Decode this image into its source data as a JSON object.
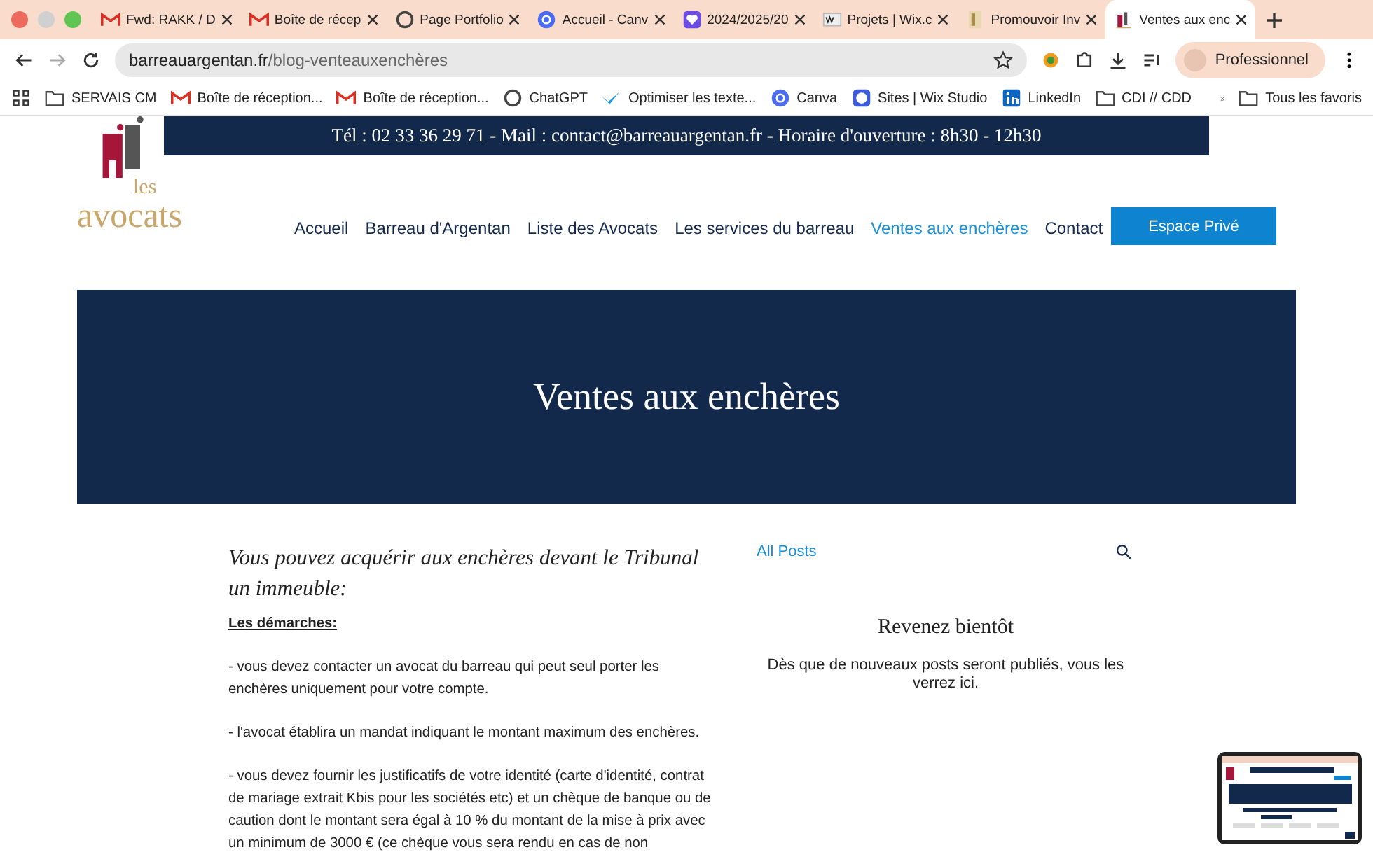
{
  "browser": {
    "tabs": [
      {
        "title": "Fwd: RAKK / D",
        "selected": false
      },
      {
        "title": "Boîte de récep",
        "selected": false
      },
      {
        "title": "Page Portfolio",
        "selected": false
      },
      {
        "title": "Accueil - Canv",
        "selected": false
      },
      {
        "title": "2024/2025/20",
        "selected": false
      },
      {
        "title": "Projets | Wix.c",
        "selected": false
      },
      {
        "title": "Promouvoir Inv",
        "selected": false
      },
      {
        "title": "Ventes aux enc",
        "selected": true
      }
    ],
    "url_host": "barreauargentan.fr",
    "url_path": "/blog-venteauxenchères",
    "profile": "Professionnel",
    "bookmarks": [
      "SERVAIS CM",
      "Boîte de réception...",
      "Boîte de réception...",
      "ChatGPT",
      "Optimiser les texte...",
      "Canva",
      "Sites | Wix Studio",
      "LinkedIn",
      "CDI // CDD"
    ],
    "all_bookmarks": "Tous les favoris"
  },
  "site": {
    "contact_before": "Tél : 02 33 36 29 71 - Mail : ",
    "contact_email": "contact@barreauargentan.fr",
    "contact_after": " - Horaire d'ouverture : 8h30 - 12h30",
    "logo_small": "les",
    "logo_big": "avocats",
    "nav": [
      {
        "label": "Accueil",
        "selected": false
      },
      {
        "label": "Barreau d'Argentan",
        "selected": false
      },
      {
        "label": "Liste des Avocats",
        "selected": false
      },
      {
        "label": "Les services du barreau",
        "selected": false
      },
      {
        "label": "Ventes aux enchères",
        "selected": true
      },
      {
        "label": "Contact",
        "selected": false
      }
    ],
    "private_button": "Espace Privé",
    "hero_title": "Ventes aux enchères",
    "intro": "Vous pouvez acquérir aux enchères devant le Tribunal un immeuble:",
    "steps_heading": "Les démarches:",
    "paragraphs": [
      "- vous devez contacter un avocat du barreau qui peut seul porter les enchères uniquement pour votre compte.",
      "- l'avocat établira un mandat indiquant le montant maximum des enchères.",
      "- vous devez fournir les justificatifs de votre identité (carte d'identité, contrat de mariage extrait Kbis pour les sociétés etc) et un chèque de banque ou de caution dont le montant sera égal à 10 % du montant de la mise à prix avec un minimum de 3000 € (ce chèque vous sera rendu en cas de non"
    ],
    "blog_link": "All Posts",
    "empty_title": "Revenez bientôt",
    "empty_text": "Dès que de nouveaux posts seront publiés, vous les verrez ici."
  }
}
